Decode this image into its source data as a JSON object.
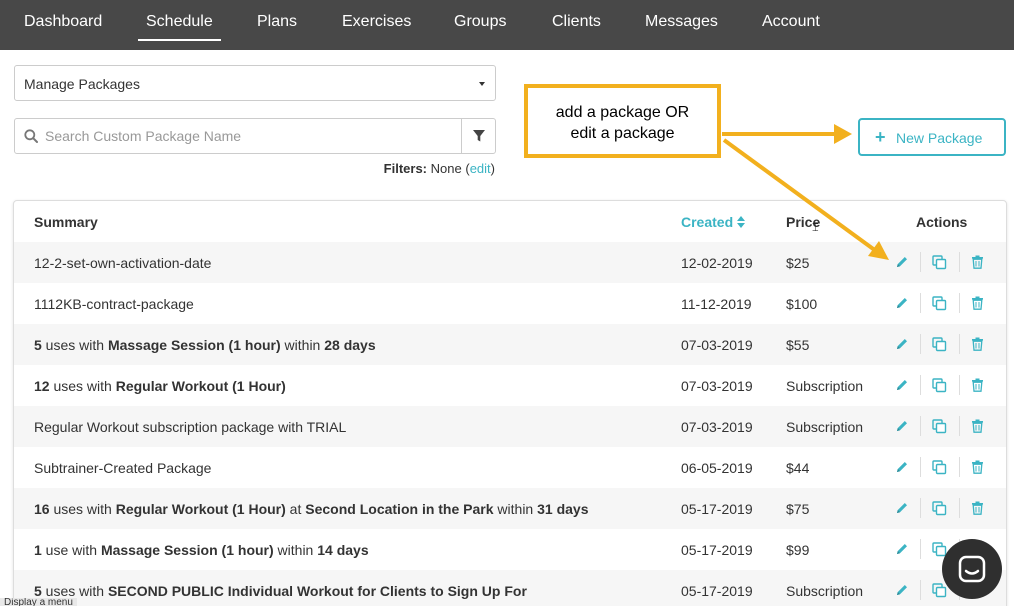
{
  "nav": {
    "items": [
      "Dashboard",
      "Schedule",
      "Plans",
      "Exercises",
      "Groups",
      "Clients",
      "Messages",
      "Account"
    ],
    "active": "Schedule"
  },
  "manage_select": {
    "value": "Manage Packages"
  },
  "search": {
    "placeholder": "Search Custom Package Name"
  },
  "filters": {
    "label": "Filters:",
    "value": "None",
    "open_paren": "(",
    "edit": "edit",
    "close_paren": ")"
  },
  "callout": {
    "line1": "add a package OR",
    "line2": "edit a package"
  },
  "new_package": {
    "plus": "+",
    "label": "New Package"
  },
  "table": {
    "headers": {
      "summary": "Summary",
      "created": "Created",
      "price": "Price",
      "actions": "Actions"
    },
    "rows": [
      {
        "summary": [
          {
            "t": "12-2-set-own-activation-date",
            "b": false
          }
        ],
        "created": "12-02-2019",
        "price": "$25"
      },
      {
        "summary": [
          {
            "t": "1112KB-contract-package",
            "b": false
          }
        ],
        "created": "11-12-2019",
        "price": "$100"
      },
      {
        "summary": [
          {
            "t": "5",
            "b": true
          },
          {
            "t": " uses with ",
            "b": false
          },
          {
            "t": "Massage Session (1 hour)",
            "b": true
          },
          {
            "t": " within ",
            "b": false
          },
          {
            "t": "28 days",
            "b": true
          }
        ],
        "created": "07-03-2019",
        "price": "$55"
      },
      {
        "summary": [
          {
            "t": "12",
            "b": true
          },
          {
            "t": " uses with ",
            "b": false
          },
          {
            "t": "Regular Workout (1 Hour)",
            "b": true
          }
        ],
        "created": "07-03-2019",
        "price": "Subscription"
      },
      {
        "summary": [
          {
            "t": "Regular Workout subscription package with TRIAL",
            "b": false
          }
        ],
        "created": "07-03-2019",
        "price": "Subscription"
      },
      {
        "summary": [
          {
            "t": "Subtrainer-Created Package",
            "b": false
          }
        ],
        "created": "06-05-2019",
        "price": "$44"
      },
      {
        "summary": [
          {
            "t": "16",
            "b": true
          },
          {
            "t": " uses with ",
            "b": false
          },
          {
            "t": "Regular Workout (1 Hour)",
            "b": true
          },
          {
            "t": " at ",
            "b": false
          },
          {
            "t": "Second Location in the Park",
            "b": true
          },
          {
            "t": " within ",
            "b": false
          },
          {
            "t": "31 days",
            "b": true
          }
        ],
        "created": "05-17-2019",
        "price": "$75"
      },
      {
        "summary": [
          {
            "t": "1",
            "b": true
          },
          {
            "t": " use with ",
            "b": false
          },
          {
            "t": "Massage Session (1 hour)",
            "b": true
          },
          {
            "t": " within ",
            "b": false
          },
          {
            "t": "14 days",
            "b": true
          }
        ],
        "created": "05-17-2019",
        "price": "$99"
      },
      {
        "summary": [
          {
            "t": "5",
            "b": true
          },
          {
            "t": " uses with ",
            "b": false
          },
          {
            "t": "SECOND PUBLIC Individual Workout for Clients to Sign Up For",
            "b": true
          }
        ],
        "created": "05-17-2019",
        "price": "Subscription"
      }
    ]
  },
  "tooltip": {
    "text": "Display a menu"
  },
  "colors": {
    "nav_bg": "#484848",
    "accent": "#3bb4c4",
    "callout_border": "#f2b01e",
    "row_alt": "#f6f6f6"
  }
}
